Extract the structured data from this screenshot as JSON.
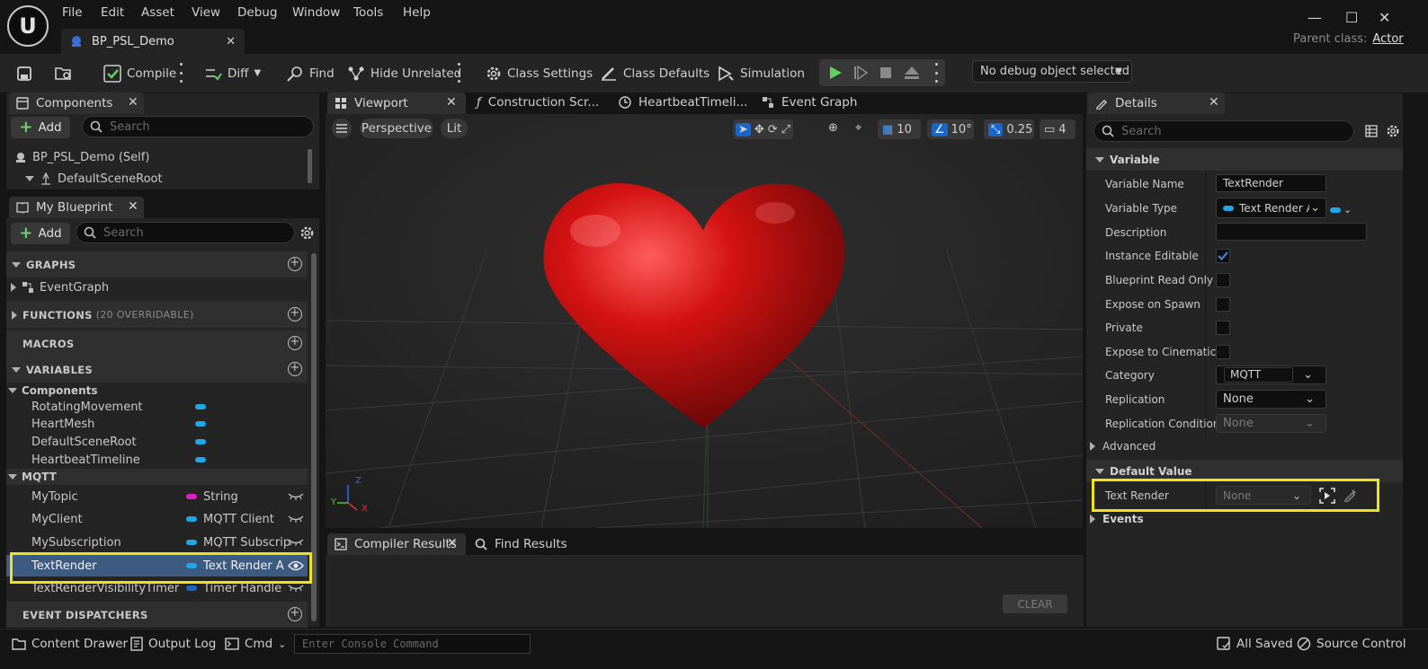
{
  "app": {
    "logo_text": "U",
    "parent_class_label": "Parent class:",
    "parent_class_value": "Actor",
    "document_tab": "BP_PSL_Demo"
  },
  "menu": [
    "File",
    "Edit",
    "Asset",
    "View",
    "Debug",
    "Window",
    "Tools",
    "Help"
  ],
  "toolbar": {
    "compile": "Compile",
    "diff": "Diff",
    "find": "Find",
    "hide_unrelated": "Hide Unrelated",
    "class_settings": "Class Settings",
    "class_defaults": "Class Defaults",
    "simulation": "Simulation",
    "debug_object": "No debug object selected"
  },
  "components_panel": {
    "tab": "Components",
    "add": "Add",
    "search_placeholder": "Search",
    "items": [
      "BP_PSL_Demo (Self)",
      "DefaultSceneRoot"
    ]
  },
  "my_blueprint": {
    "tab": "My Blueprint",
    "add": "Add",
    "search_placeholder": "Search",
    "graphs_header": "GRAPHS",
    "event_graph": "EventGraph",
    "functions_header": "FUNCTIONS",
    "functions_note": "(20 OVERRIDABLE)",
    "macros_header": "MACROS",
    "variables_header": "VARIABLES",
    "components_category": "Components",
    "component_vars": [
      "RotatingMovement",
      "HeartMesh",
      "DefaultSceneRoot",
      "HeartbeatTimeline"
    ],
    "mqtt_category": "MQTT",
    "mqtt_vars": [
      {
        "name": "MyTopic",
        "type": "String",
        "color": "#e21ec8"
      },
      {
        "name": "MyClient",
        "type": "MQTT Client",
        "color": "#1ea8e8"
      },
      {
        "name": "MySubscription",
        "type": "MQTT Subscrip",
        "color": "#1ea8e8"
      },
      {
        "name": "TextRender",
        "type": "Text Render Act",
        "color": "#1ea8e8"
      },
      {
        "name": "TextRenderVisibilityTimer",
        "type": "Timer Handle",
        "color": "#1a66c8"
      }
    ],
    "event_dispatchers_header": "EVENT DISPATCHERS"
  },
  "editor_tabs": [
    "Viewport",
    "Construction Scr...",
    "HeartbeatTimeli...",
    "Event Graph"
  ],
  "viewport": {
    "perspective": "Perspective",
    "lit": "Lit",
    "grid_snap": "10",
    "rotation_snap": "10°",
    "scale_snap": "0.25",
    "camera_speed": "4",
    "axis_labels": {
      "x": "X",
      "y": "Y",
      "z": "Z"
    }
  },
  "bottom_panel": {
    "compiler_results_tab": "Compiler Results",
    "find_results_tab": "Find Results",
    "clear": "CLEAR"
  },
  "details": {
    "tab": "Details",
    "search_placeholder": "Search",
    "variable_section": "Variable",
    "rows": {
      "variable_name": {
        "label": "Variable Name",
        "value": "TextRender"
      },
      "variable_type": {
        "label": "Variable Type",
        "value": "Text Render A"
      },
      "description": {
        "label": "Description",
        "value": ""
      },
      "instance_editable": {
        "label": "Instance Editable",
        "checked": true
      },
      "blueprint_read_only": {
        "label": "Blueprint Read Only",
        "checked": false
      },
      "expose_on_spawn": {
        "label": "Expose on Spawn",
        "checked": false
      },
      "private": {
        "label": "Private",
        "checked": false
      },
      "expose_to_cinematics": {
        "label": "Expose to Cinematics",
        "checked": false
      },
      "category": {
        "label": "Category",
        "value": "MQTT"
      },
      "replication": {
        "label": "Replication",
        "value": "None"
      },
      "replication_condition": {
        "label": "Replication Condition",
        "value": "None"
      }
    },
    "advanced": "Advanced",
    "default_value_section": "Default Value",
    "text_render": {
      "label": "Text Render",
      "value": "None"
    },
    "events": "Events"
  },
  "statusbar": {
    "content_drawer": "Content Drawer",
    "output_log": "Output Log",
    "cmd": "Cmd",
    "console_placeholder": "Enter Console Command",
    "all_saved": "All Saved",
    "source_control": "Source Control"
  },
  "colors": {
    "highlight": "#f0e219",
    "accent_blue": "#1ea8e8",
    "play_green": "#5fd35f",
    "heart_red": "#d41212"
  }
}
